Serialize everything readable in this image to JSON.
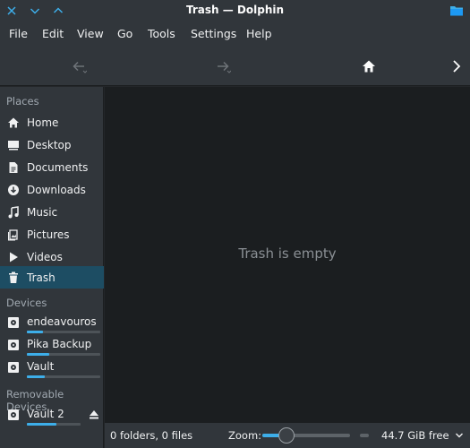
{
  "window": {
    "title": "Trash — Dolphin"
  },
  "menu": [
    "File",
    "Edit",
    "View",
    "Go",
    "Tools",
    "Settings",
    "Help"
  ],
  "sidebar": {
    "places_header": "Places",
    "places": [
      {
        "label": "Home",
        "icon": "home-icon"
      },
      {
        "label": "Desktop",
        "icon": "desktop-icon"
      },
      {
        "label": "Documents",
        "icon": "documents-icon"
      },
      {
        "label": "Downloads",
        "icon": "downloads-icon"
      },
      {
        "label": "Music",
        "icon": "music-icon"
      },
      {
        "label": "Pictures",
        "icon": "pictures-icon"
      },
      {
        "label": "Videos",
        "icon": "videos-icon"
      },
      {
        "label": "Trash",
        "icon": "trash-icon",
        "active": true
      }
    ],
    "devices_header": "Devices",
    "devices": [
      {
        "label": "endeavouros",
        "used_fraction": 0.22
      },
      {
        "label": "Pika Backup",
        "used_fraction": 0.3
      },
      {
        "label": "Vault",
        "used_fraction": 0.24
      }
    ],
    "removable_header": "Removable Devices",
    "removable": [
      {
        "label": "Vault 2",
        "used_fraction": 0.55
      }
    ]
  },
  "main": {
    "empty_message": "Trash is empty"
  },
  "statusbar": {
    "summary": "0 folders, 0 files",
    "zoom_label": "Zoom:",
    "zoom_fraction": 0.28,
    "free_space": "44.7 GiB free"
  },
  "colors": {
    "accent": "#3daee9",
    "selection": "#1d4d63",
    "window_bg": "#31363b",
    "view_bg": "#1b1e20"
  }
}
